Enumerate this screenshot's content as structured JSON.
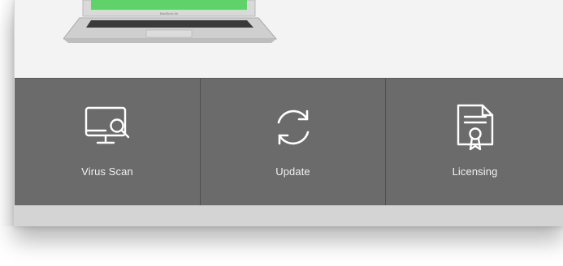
{
  "laptop": {
    "brand_label": "MacBook Air"
  },
  "actions": [
    {
      "label": "Virus Scan",
      "icon": "monitor-search-icon"
    },
    {
      "label": "Update",
      "icon": "refresh-icon"
    },
    {
      "label": "Licensing",
      "icon": "certificate-icon"
    }
  ],
  "colors": {
    "action_bar_bg": "#6b6b6b",
    "screen_green": "#5fd36a",
    "icon_stroke": "#ffffff"
  }
}
